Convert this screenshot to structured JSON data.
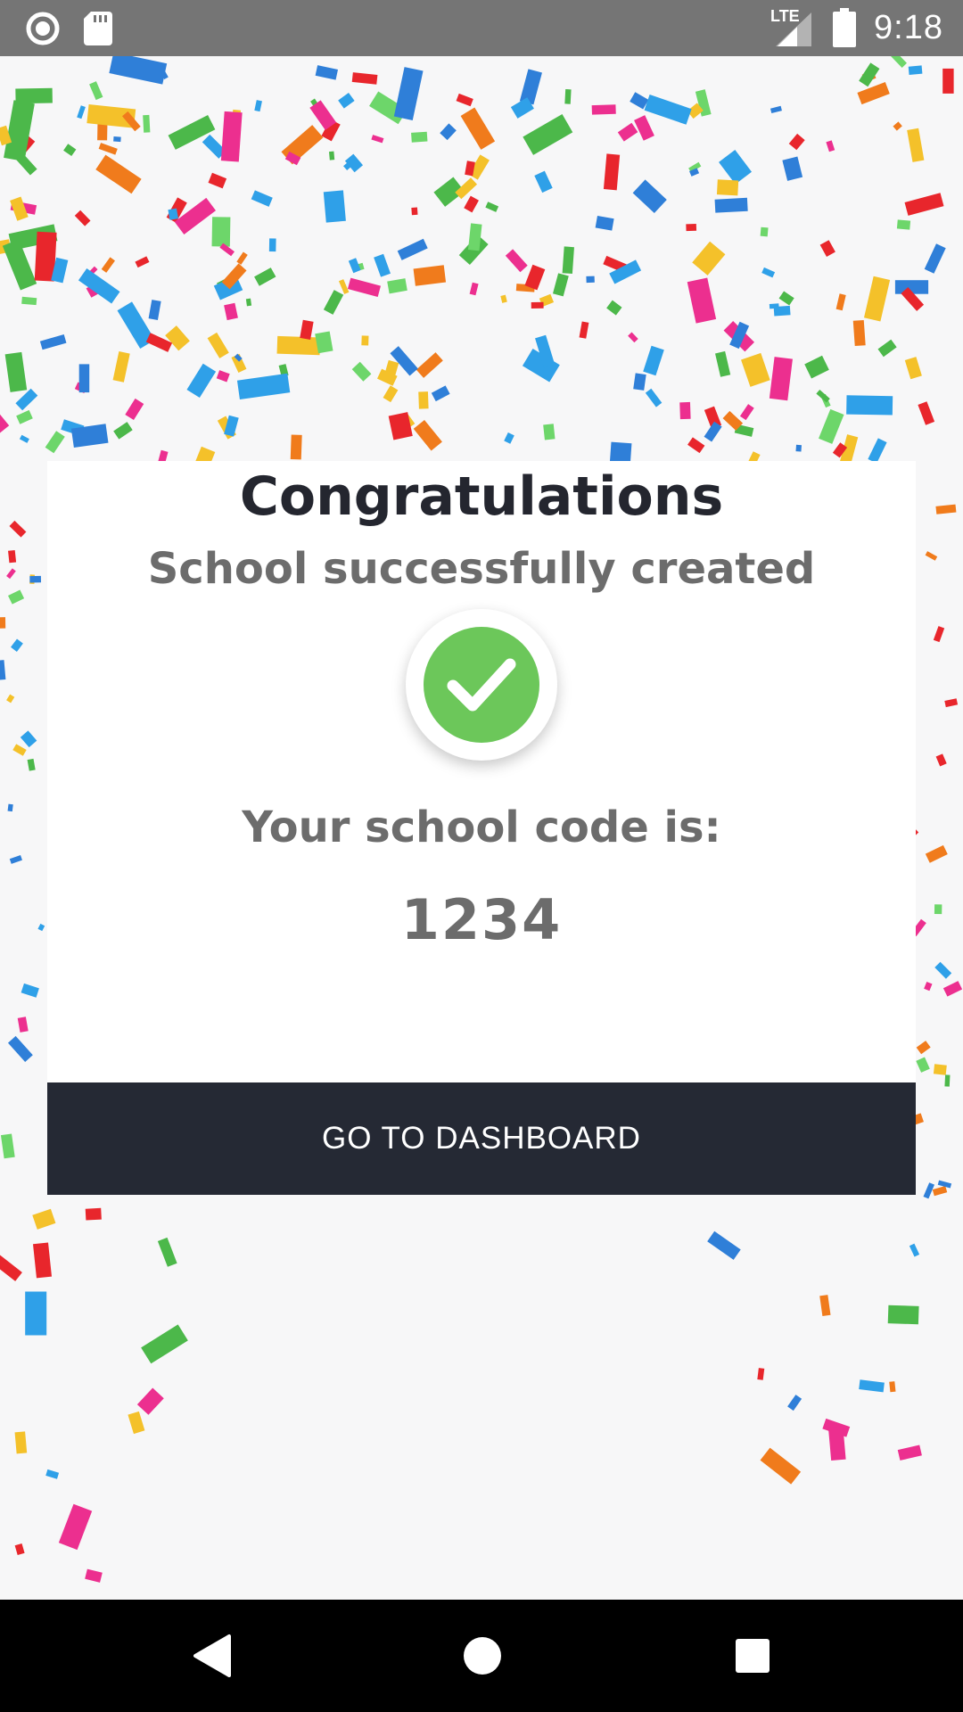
{
  "status_bar": {
    "time": "9:18",
    "network": "LTE",
    "icons": [
      "record-icon",
      "sd-card-icon",
      "signal-icon",
      "battery-icon"
    ]
  },
  "card": {
    "title": "Congratulations",
    "subtitle": "School successfully created",
    "code_label": "Your school code is:",
    "code_value": "1234",
    "check_icon": "check-circle-icon"
  },
  "button": {
    "label": "GO TO DASHBOARD"
  },
  "nav_bar": {
    "icons": [
      "back-icon",
      "home-icon",
      "recents-icon"
    ]
  },
  "colors": {
    "status_bar": "#757575",
    "button_bg": "#252934",
    "title": "#24262f",
    "text_gray": "#6c6c6c",
    "success_green": "#6cc75a"
  }
}
